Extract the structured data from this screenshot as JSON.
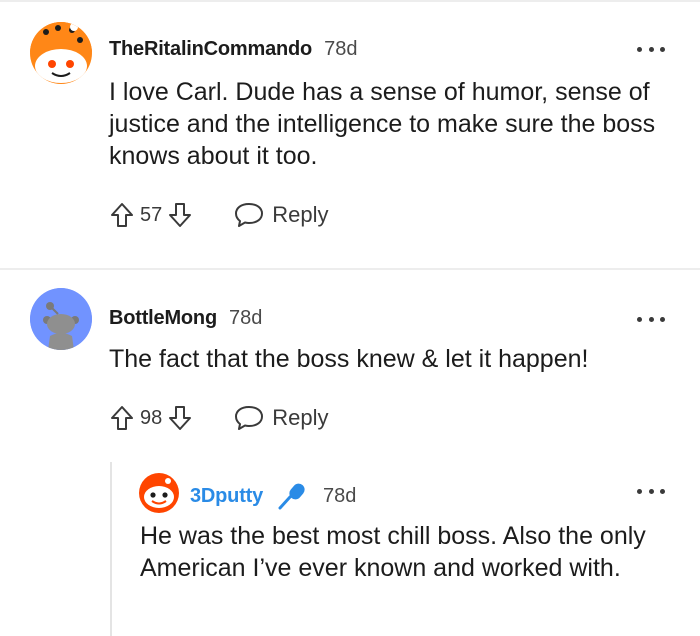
{
  "comments": [
    {
      "username": "TheRitalinCommando",
      "time": "78d",
      "body": "I love Carl. Dude has a sense of humor, sense of justice and the intelligence to make sure the boss knows about it too.",
      "score": "57",
      "reply_label": "Reply",
      "avatar_color": "#ff8717"
    },
    {
      "username": "BottleMong",
      "time": "78d",
      "body": "The fact that the boss knew & let it happen!",
      "score": "98",
      "reply_label": "Reply",
      "avatar_color": "#7193ff"
    },
    {
      "username": "3Dputty",
      "time": "78d",
      "body": "He was the best most chill boss. Also the only American I’ve ever known and worked with.",
      "flair_icon": "microphone-icon",
      "username_color": "#2a8be6",
      "avatar_color": "#ff4500"
    }
  ],
  "icons": {
    "upvote": "arrow-up-icon",
    "downvote": "arrow-down-icon",
    "reply": "speech-bubble-icon",
    "more": "more-options-icon"
  }
}
